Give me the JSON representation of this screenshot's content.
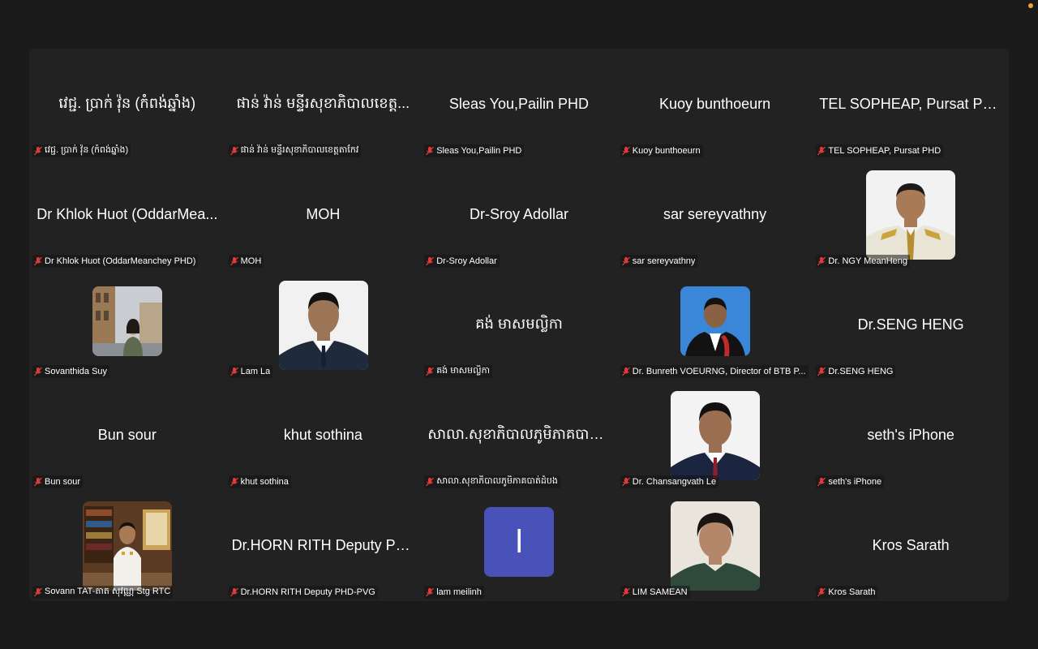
{
  "colors": {
    "background": "#1a1a1a",
    "gallery_background": "#222222",
    "muted_icon": "#e03a3a",
    "avatar_initial_bg": "#4852b8",
    "status_dot": "#f0a030"
  },
  "participants": [
    {
      "center_name": "វេជ្ជ. ប្រាក់ វ៉ុន (កំពង់ឆ្នាំង)",
      "label": "វេជ្ជ. ប្រាក់ វ៉ុន (កំពង់ឆ្នាំង)",
      "muted": true
    },
    {
      "center_name": "ផាន់ វ៉ាន់ មន្ទីរសុខាភិបាលខេត្ត...",
      "label": "ផាន់ វ៉ាន់ មន្ទីរសុខាភិបាលខេត្តតាកែវ",
      "muted": true
    },
    {
      "center_name": "Sleas You,Pailin PHD",
      "label": "Sleas You,Pailin PHD",
      "muted": true
    },
    {
      "center_name": "Kuoy bunthoeurn",
      "label": "Kuoy bunthoeurn",
      "muted": true
    },
    {
      "center_name": "TEL SOPHEAP, Pursat PHD",
      "label": "TEL SOPHEAP, Pursat PHD",
      "muted": true
    },
    {
      "center_name": "Dr Khlok Huot (OddarMea...",
      "label": "Dr Khlok Huot (OddarMeanchey PHD)",
      "muted": true
    },
    {
      "center_name": "MOH",
      "label": "MOH",
      "muted": true
    },
    {
      "center_name": "Dr-Sroy Adollar",
      "label": "Dr-Sroy Adollar",
      "muted": true
    },
    {
      "center_name": "sar sereyvathny",
      "label": "sar sereyvathny",
      "muted": true
    },
    {
      "center_name": "",
      "label": "Dr. NGY MeanHeng",
      "muted": true,
      "photo": "uniform-portrait"
    },
    {
      "center_name": "",
      "label": "Sovanthida Suy",
      "muted": true,
      "photo": "street-photo"
    },
    {
      "center_name": "",
      "label": "Lam La",
      "muted": true,
      "photo": "suit-portrait"
    },
    {
      "center_name": "គង់ មាសមល្លិកា",
      "label": "គង់ មាសមល្លិកា",
      "muted": true
    },
    {
      "center_name": "",
      "label": "Dr. Bunreth VOEURNG, Director of BTB P...",
      "muted": true,
      "photo": "robe-portrait"
    },
    {
      "center_name": "Dr.SENG HENG",
      "label": "Dr.SENG HENG",
      "muted": true
    },
    {
      "center_name": "Bun sour",
      "label": "Bun sour",
      "muted": true
    },
    {
      "center_name": "khut sothina",
      "label": "khut sothina",
      "muted": true
    },
    {
      "center_name": "សាលា.សុខាភិបាលភូមិភាគបាត់...",
      "label": "សាលា.សុខាភិបាលភូមិភាគបាត់ដំបង",
      "muted": true
    },
    {
      "center_name": "",
      "label": "Dr. Chansangvath Le",
      "muted": true,
      "photo": "suit-portrait-2"
    },
    {
      "center_name": "seth's iPhone",
      "label": "seth's iPhone",
      "muted": true
    },
    {
      "center_name": "",
      "label": "Sovann TAT-តាត សុវណ្ណ  Stg RTC",
      "muted": true,
      "photo": "library-uniform"
    },
    {
      "center_name": "Dr.HORN RITH Deputy PH...",
      "label": "Dr.HORN RITH Deputy PHD-PVG",
      "muted": true
    },
    {
      "center_name": "",
      "label": "lam meilinh",
      "muted": true,
      "avatar_initial": "l"
    },
    {
      "center_name": "",
      "label": "LIM SAMEAN",
      "muted": true,
      "photo": "woman-portrait"
    },
    {
      "center_name": "Kros Sarath",
      "label": "Kros Sarath",
      "muted": true
    }
  ]
}
